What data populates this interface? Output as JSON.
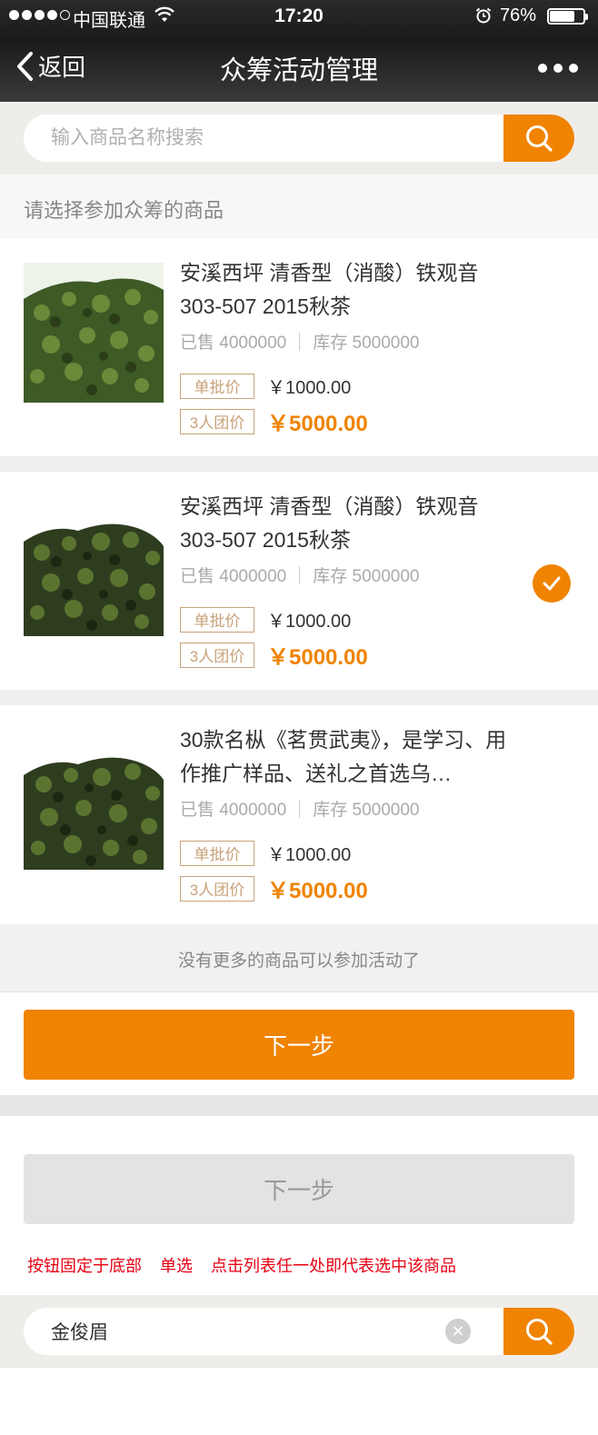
{
  "status_bar": {
    "carrier": "中国联通",
    "time": "17:20",
    "battery": "76%"
  },
  "nav": {
    "back_label": "返回",
    "title": "众筹活动管理"
  },
  "search": {
    "placeholder": "输入商品名称搜索"
  },
  "section_label": "请选择参加众筹的商品",
  "products": [
    {
      "title": "安溪西坪 清香型（消酸）铁观音 303-507  2015秋茶",
      "sold": "已售 4000000",
      "stock": "库存 5000000",
      "single_tag": "单批价",
      "single_price": "￥1000.00",
      "group_tag": "3人团价",
      "group_price": "￥5000.00",
      "selected": false
    },
    {
      "title": "安溪西坪 清香型（消酸）铁观音 303-507  2015秋茶",
      "sold": "已售 4000000",
      "stock": "库存 5000000",
      "single_tag": "单批价",
      "single_price": "￥1000.00",
      "group_tag": "3人团价",
      "group_price": "￥5000.00",
      "selected": true
    },
    {
      "title": "30款名枞《茗贯武夷》，是学习、用作推广样品、送礼之首选乌…",
      "sold": "已售 4000000",
      "stock": "库存 5000000",
      "single_tag": "单批价",
      "single_price": "￥1000.00",
      "group_tag": "3人团价",
      "group_price": "￥5000.00",
      "selected": false
    }
  ],
  "no_more_text": "没有更多的商品可以参加活动了",
  "next_button": "下一步",
  "next_button_disabled": "下一步",
  "notes": [
    "按钮固定于底部",
    "单选",
    "点击列表任一处即代表选中该商品"
  ],
  "search_filled": {
    "value": "金俊眉"
  },
  "colors": {
    "accent": "#f08300",
    "tag_border": "#c8a27a",
    "note_red": "#e60012"
  }
}
